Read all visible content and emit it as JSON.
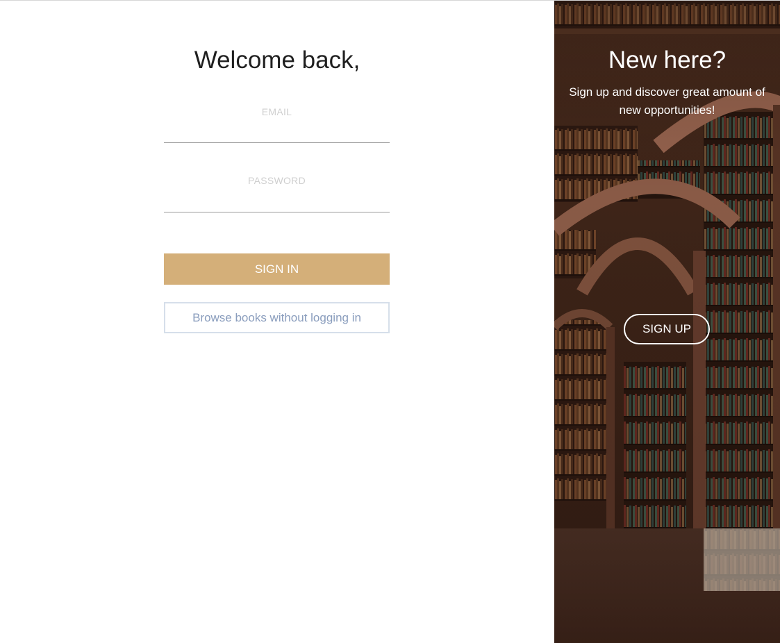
{
  "login": {
    "title": "Welcome back,",
    "email_label": "EMAIL",
    "email_value": "",
    "password_label": "PASSWORD",
    "password_value": "",
    "sign_in_label": "SIGN IN",
    "browse_label": "Browse books without logging in"
  },
  "promo": {
    "title": "New here?",
    "text": "Sign up and discover great amount of new opportunities!",
    "sign_up_label": "SIGN UP",
    "background_icon": "library-bookshelves-illustration"
  },
  "colors": {
    "accent": "#d4af79",
    "browse_text": "#8a9dbd",
    "browse_border": "#d6dfea",
    "label_text": "#cfcfcf",
    "panel_dark": "#3b2218"
  }
}
